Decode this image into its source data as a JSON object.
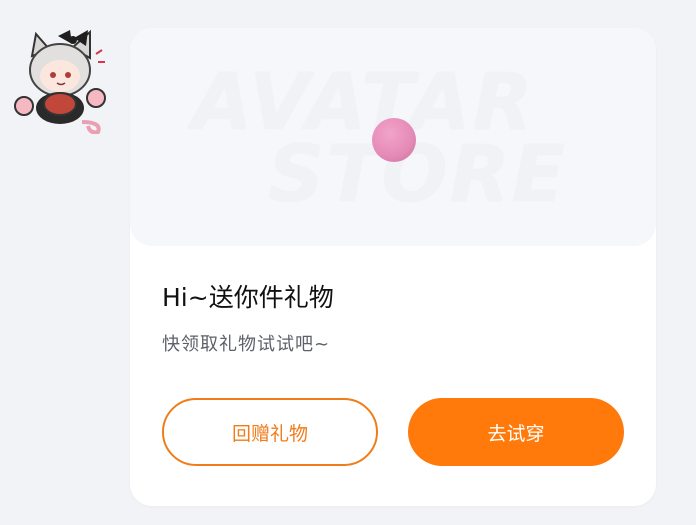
{
  "avatar": {
    "alt": "anime cat-ear girl avatar sticker"
  },
  "banner": {
    "watermark_line1": "AVATAR",
    "watermark_line2": "STORE"
  },
  "card": {
    "title": "Hi~送你件礼物",
    "subtitle": "快领取礼物试试吧~"
  },
  "buttons": {
    "gift_back_label": "回赠礼物",
    "try_on_label": "去试穿"
  },
  "colors": {
    "accent": "#ff7a0a",
    "page_bg": "#f2f3f6",
    "card_bg": "#ffffff",
    "pink_dot": "#e48ab7"
  }
}
